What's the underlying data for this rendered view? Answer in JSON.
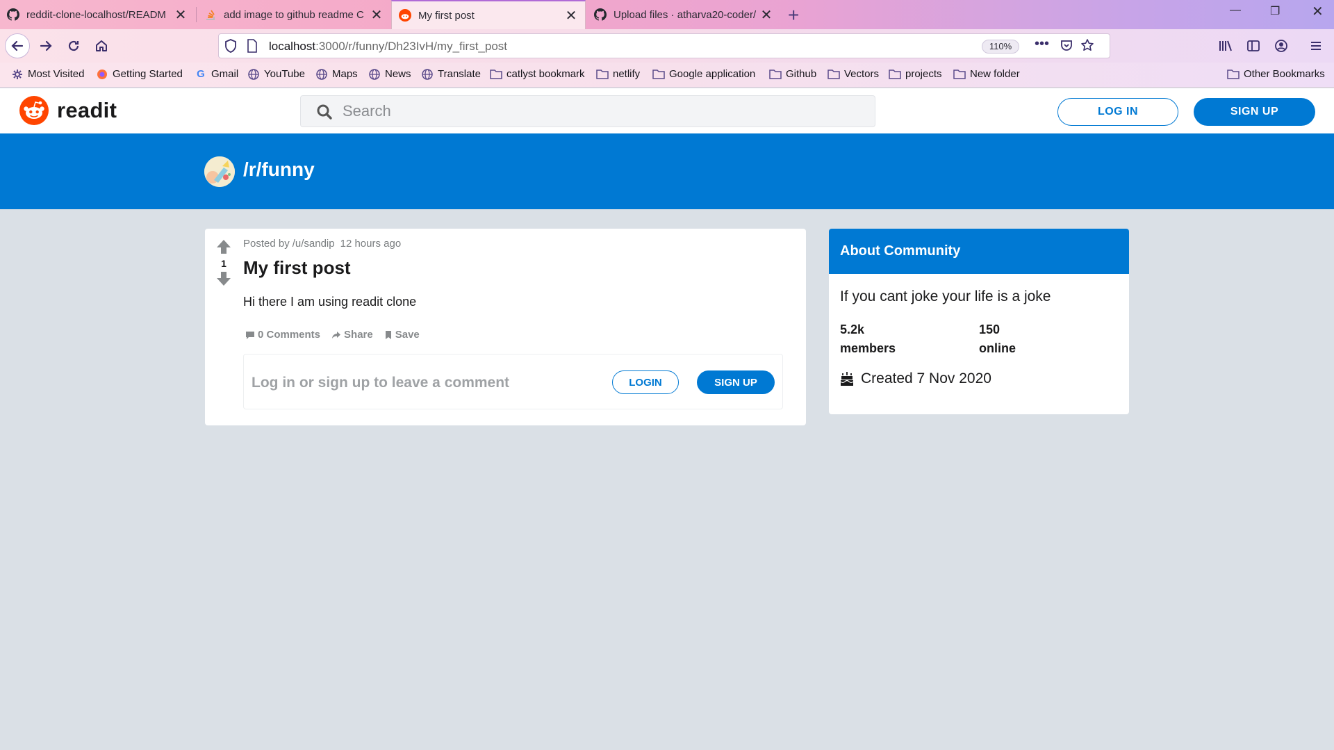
{
  "browser": {
    "tabs": [
      {
        "title": "reddit-clone-localhost/READM",
        "icon": "github-icon",
        "active": false
      },
      {
        "title": "add image to github readme C",
        "icon": "stackoverflow-icon",
        "active": false
      },
      {
        "title": "My first post",
        "icon": "reddit-icon",
        "active": true
      },
      {
        "title": "Upload files · atharva20-coder/",
        "icon": "github-icon",
        "active": false
      }
    ],
    "url_host": "localhost",
    "url_path": ":3000/r/funny/Dh23IvH/my_first_post",
    "zoom": "110%",
    "bookmarks": [
      {
        "label": "Most Visited",
        "icon": "gear-icon"
      },
      {
        "label": "Getting Started",
        "icon": "firefox-icon"
      },
      {
        "label": "Gmail",
        "icon": "google-icon"
      },
      {
        "label": "YouTube",
        "icon": "globe-icon"
      },
      {
        "label": "Maps",
        "icon": "globe-icon"
      },
      {
        "label": "News",
        "icon": "globe-icon"
      },
      {
        "label": "Translate",
        "icon": "globe-icon"
      },
      {
        "label": "catlyst bookmark",
        "icon": "folder-icon"
      },
      {
        "label": "netlify",
        "icon": "folder-icon"
      },
      {
        "label": "Google application",
        "icon": "folder-icon"
      },
      {
        "label": "Github",
        "icon": "folder-icon"
      },
      {
        "label": "Vectors",
        "icon": "folder-icon"
      },
      {
        "label": "projects",
        "icon": "folder-icon"
      },
      {
        "label": "New folder",
        "icon": "folder-icon"
      }
    ],
    "other_bookmarks": "Other Bookmarks"
  },
  "header": {
    "logo_text": "readit",
    "search_placeholder": "Search",
    "login_label": "LOG IN",
    "signup_label": "SIGN UP"
  },
  "banner": {
    "subreddit": "/r/funny"
  },
  "post": {
    "posted_by_label": "Posted by",
    "author": "/u/sandip",
    "time": "12 hours ago",
    "votes": "1",
    "title": "My first post",
    "body": "Hi there I am using readit clone",
    "comments_label": "0 Comments",
    "share_label": "Share",
    "save_label": "Save",
    "comment_prompt": "Log in or sign up to leave a comment",
    "comment_login_label": "LOGIN",
    "comment_signup_label": "SIGN UP"
  },
  "about": {
    "heading": "About Community",
    "description": "If you cant joke your life is a joke",
    "members_count": "5.2k",
    "members_label": "members",
    "online_count": "150",
    "online_label": "online",
    "created": "Created 7 Nov 2020"
  },
  "colors": {
    "accent": "#0079d3",
    "background": "#dae0e6",
    "reddit_orange": "#ff4500"
  }
}
